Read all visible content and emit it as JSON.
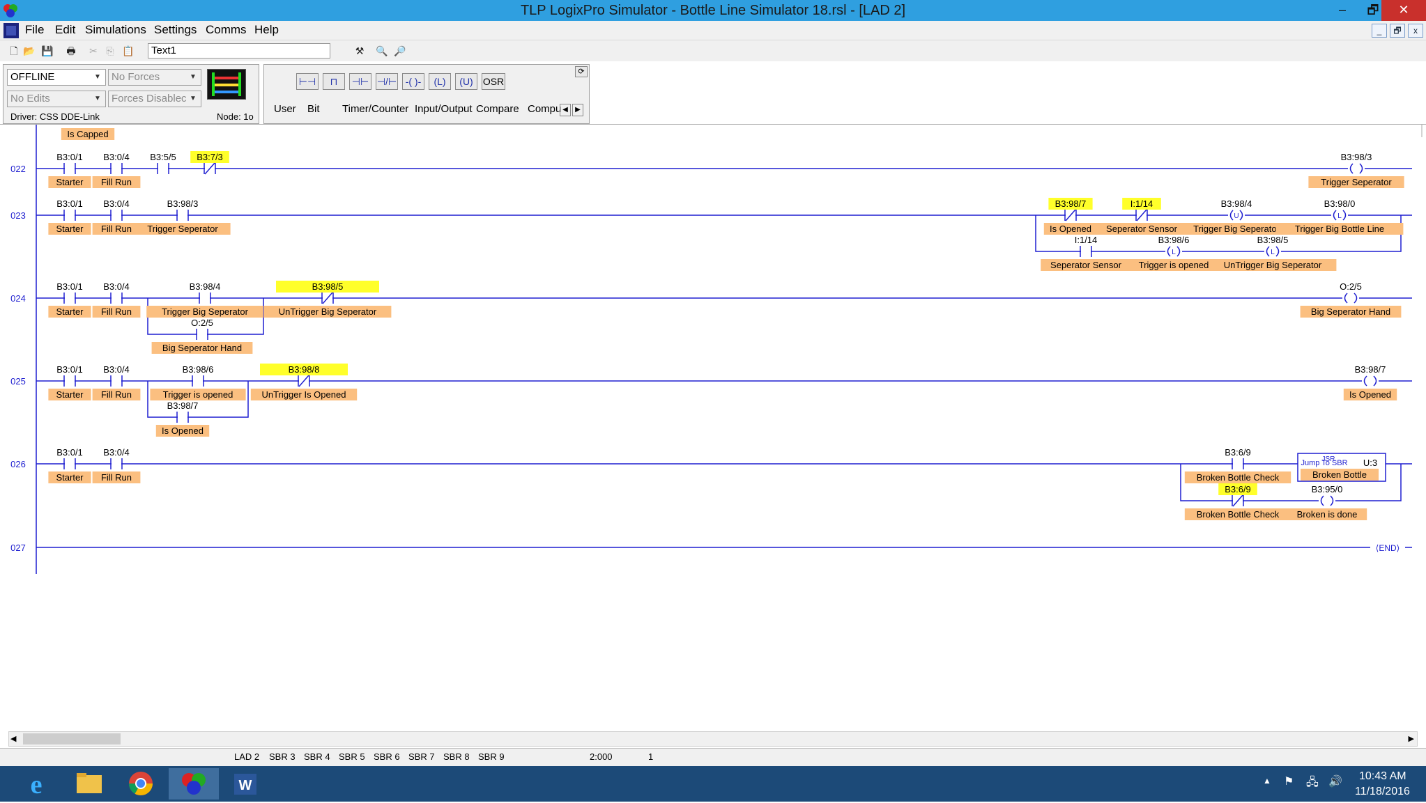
{
  "window": {
    "title": "TLP LogixPro Simulator  -  Bottle Line Simulator 18.rsl - [LAD 2]",
    "minimize": "–",
    "restore": "🗗",
    "close": "✕"
  },
  "menu": [
    "File",
    "Edit",
    "Simulations",
    "Settings",
    "Comms",
    "Help"
  ],
  "mdi_buttons": [
    "_",
    "🗗",
    "x"
  ],
  "toolbar": {
    "text_value": "Text1"
  },
  "status_panel": {
    "mode": "OFFLINE",
    "forces": "No Forces",
    "edits": "No Edits",
    "forces_state": "Forces Disablec",
    "driver": "Driver:  CSS DDE-Link",
    "node": "Node: 1o"
  },
  "instruction_panel": {
    "osr": "OSR",
    "tabs": [
      "User",
      "Bit",
      "Timer/Counter",
      "Input/Output",
      "Compare",
      "Compu"
    ]
  },
  "ladder": {
    "top_label": "Is Capped",
    "end_label": "END",
    "rungs": [
      {
        "num": "022",
        "elems": [
          {
            "t": "XIC",
            "addr": "B3:0/1",
            "desc": "Starter"
          },
          {
            "t": "XIC",
            "addr": "B3:0/4",
            "desc": "Fill Run"
          },
          {
            "t": "XIC",
            "addr": "B3:5/5",
            "desc": ""
          },
          {
            "t": "XIO",
            "addr": "B3:7/3",
            "desc": "",
            "hl": true
          },
          {
            "t": "OTE",
            "addr": "B3:98/3",
            "desc": "Trigger Seperator"
          }
        ]
      },
      {
        "num": "023",
        "elems": [
          {
            "t": "XIC",
            "addr": "B3:0/1",
            "desc": "Starter"
          },
          {
            "t": "XIC",
            "addr": "B3:0/4",
            "desc": "Fill Run"
          },
          {
            "t": "XIC",
            "addr": "B3:98/3",
            "desc": "Trigger Seperator"
          },
          {
            "t": "XIO",
            "addr": "B3:98/7",
            "desc": "Is Opened",
            "hl": true
          },
          {
            "t": "XIO",
            "addr": "I:1/14",
            "desc": "Seperator Sensor",
            "hl": true
          },
          {
            "t": "OTU",
            "addr": "B3:98/4",
            "desc": "Trigger Big Seperator"
          },
          {
            "t": "OTL",
            "addr": "B3:98/0",
            "desc": "Trigger Big Bottle Line"
          },
          {
            "t": "XIC",
            "addr": "I:1/14",
            "desc": "Seperator Sensor"
          },
          {
            "t": "OTL",
            "addr": "B3:98/6",
            "desc": "Trigger is opened"
          },
          {
            "t": "OTL",
            "addr": "B3:98/5",
            "desc": "UnTrigger Big Seperator"
          }
        ]
      },
      {
        "num": "024",
        "elems": [
          {
            "t": "XIC",
            "addr": "B3:0/1",
            "desc": "Starter"
          },
          {
            "t": "XIC",
            "addr": "B3:0/4",
            "desc": "Fill Run"
          },
          {
            "t": "XIC",
            "addr": "B3:98/4",
            "desc": "Trigger Big Seperator"
          },
          {
            "t": "XIO",
            "addr": "B3:98/5",
            "desc": "UnTrigger Big Seperator",
            "hl": true
          },
          {
            "t": "OTE",
            "addr": "O:2/5",
            "desc": "Big Seperator Hand"
          },
          {
            "t": "XIC",
            "addr": "O:2/5",
            "desc": "Big Seperator Hand"
          }
        ]
      },
      {
        "num": "025",
        "elems": [
          {
            "t": "XIC",
            "addr": "B3:0/1",
            "desc": "Starter"
          },
          {
            "t": "XIC",
            "addr": "B3:0/4",
            "desc": "Fill Run"
          },
          {
            "t": "XIC",
            "addr": "B3:98/6",
            "desc": "Trigger is opened"
          },
          {
            "t": "XIO",
            "addr": "B3:98/8",
            "desc": "UnTrigger Is Opened",
            "hl": true
          },
          {
            "t": "OTE",
            "addr": "B3:98/7",
            "desc": "Is Opened"
          },
          {
            "t": "XIC",
            "addr": "B3:98/7",
            "desc": "Is Opened"
          }
        ]
      },
      {
        "num": "026",
        "elems": [
          {
            "t": "XIC",
            "addr": "B3:0/1",
            "desc": "Starter"
          },
          {
            "t": "XIC",
            "addr": "B3:0/4",
            "desc": "Fill Run"
          },
          {
            "t": "XIC",
            "addr": "B3:6/9",
            "desc": "Broken Bottle Check"
          },
          {
            "t": "JSR",
            "addr": "U:3",
            "desc": "Broken Bottle",
            "title": "JSR",
            "sub": "Jump To SBR"
          },
          {
            "t": "XIO",
            "addr": "B3:6/9",
            "desc": "Broken Bottle Check",
            "hl": true
          },
          {
            "t": "OTE",
            "addr": "B3:95/0",
            "desc": "Broken is done"
          }
        ]
      },
      {
        "num": "027",
        "elems": []
      }
    ]
  },
  "file_tabs": [
    "LAD 2",
    "SBR 3",
    "SBR 4",
    "SBR 5",
    "SBR 6",
    "SBR 7",
    "SBR 8",
    "SBR 9"
  ],
  "status": {
    "address": "2:000",
    "page": "1"
  },
  "taskbar": {
    "time": "10:43 AM",
    "date": "11/18/2016"
  }
}
